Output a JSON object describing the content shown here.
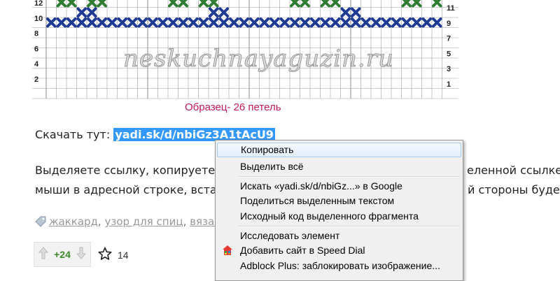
{
  "chart": {
    "watermark": "neskuchnayaguzin.ru",
    "caption": "Образец- 26 петель",
    "rows_left": [
      "12",
      "10",
      "8",
      "6",
      "4",
      "2"
    ],
    "rows_right": [
      "11",
      "9",
      "7",
      "5",
      "3",
      "1"
    ],
    "colors": {
      "green": "#2e7d32",
      "blue": "#1f3a93",
      "grid": "#9e9e9e"
    }
  },
  "article": {
    "download_label": "Скачать тут: ",
    "download_link": "yadi.sk/d/nbiGz3A1tAcU9",
    "para_line1_left": "Выделяете ссылку, копируете (",
    "para_line1_right": "еленной ссылке)",
    "para_line2_left": "мыши в адресной строке, вста",
    "para_line2_right": "й стороны будет"
  },
  "tags": {
    "icon": "tag-icon",
    "items": [
      "жаккард",
      "узор для спиц",
      "вязани"
    ]
  },
  "voting": {
    "count": "+24",
    "favorites": "14"
  },
  "context_menu": {
    "items": [
      {
        "label": "Копировать",
        "highlighted": true
      },
      {
        "label": "Выделить всё"
      },
      {
        "label": "Искать «yadi.sk/d/nbiGz...» в Google"
      },
      {
        "label": "Поделиться выделенным текстом"
      },
      {
        "label": "Исходный код выделенного фрагмента"
      },
      {
        "label": "Исследовать элемент"
      },
      {
        "label": "Добавить сайт в Speed Dial",
        "icon": "speed-dial-icon"
      },
      {
        "label": "Adblock Plus: заблокировать изображение..."
      }
    ]
  }
}
